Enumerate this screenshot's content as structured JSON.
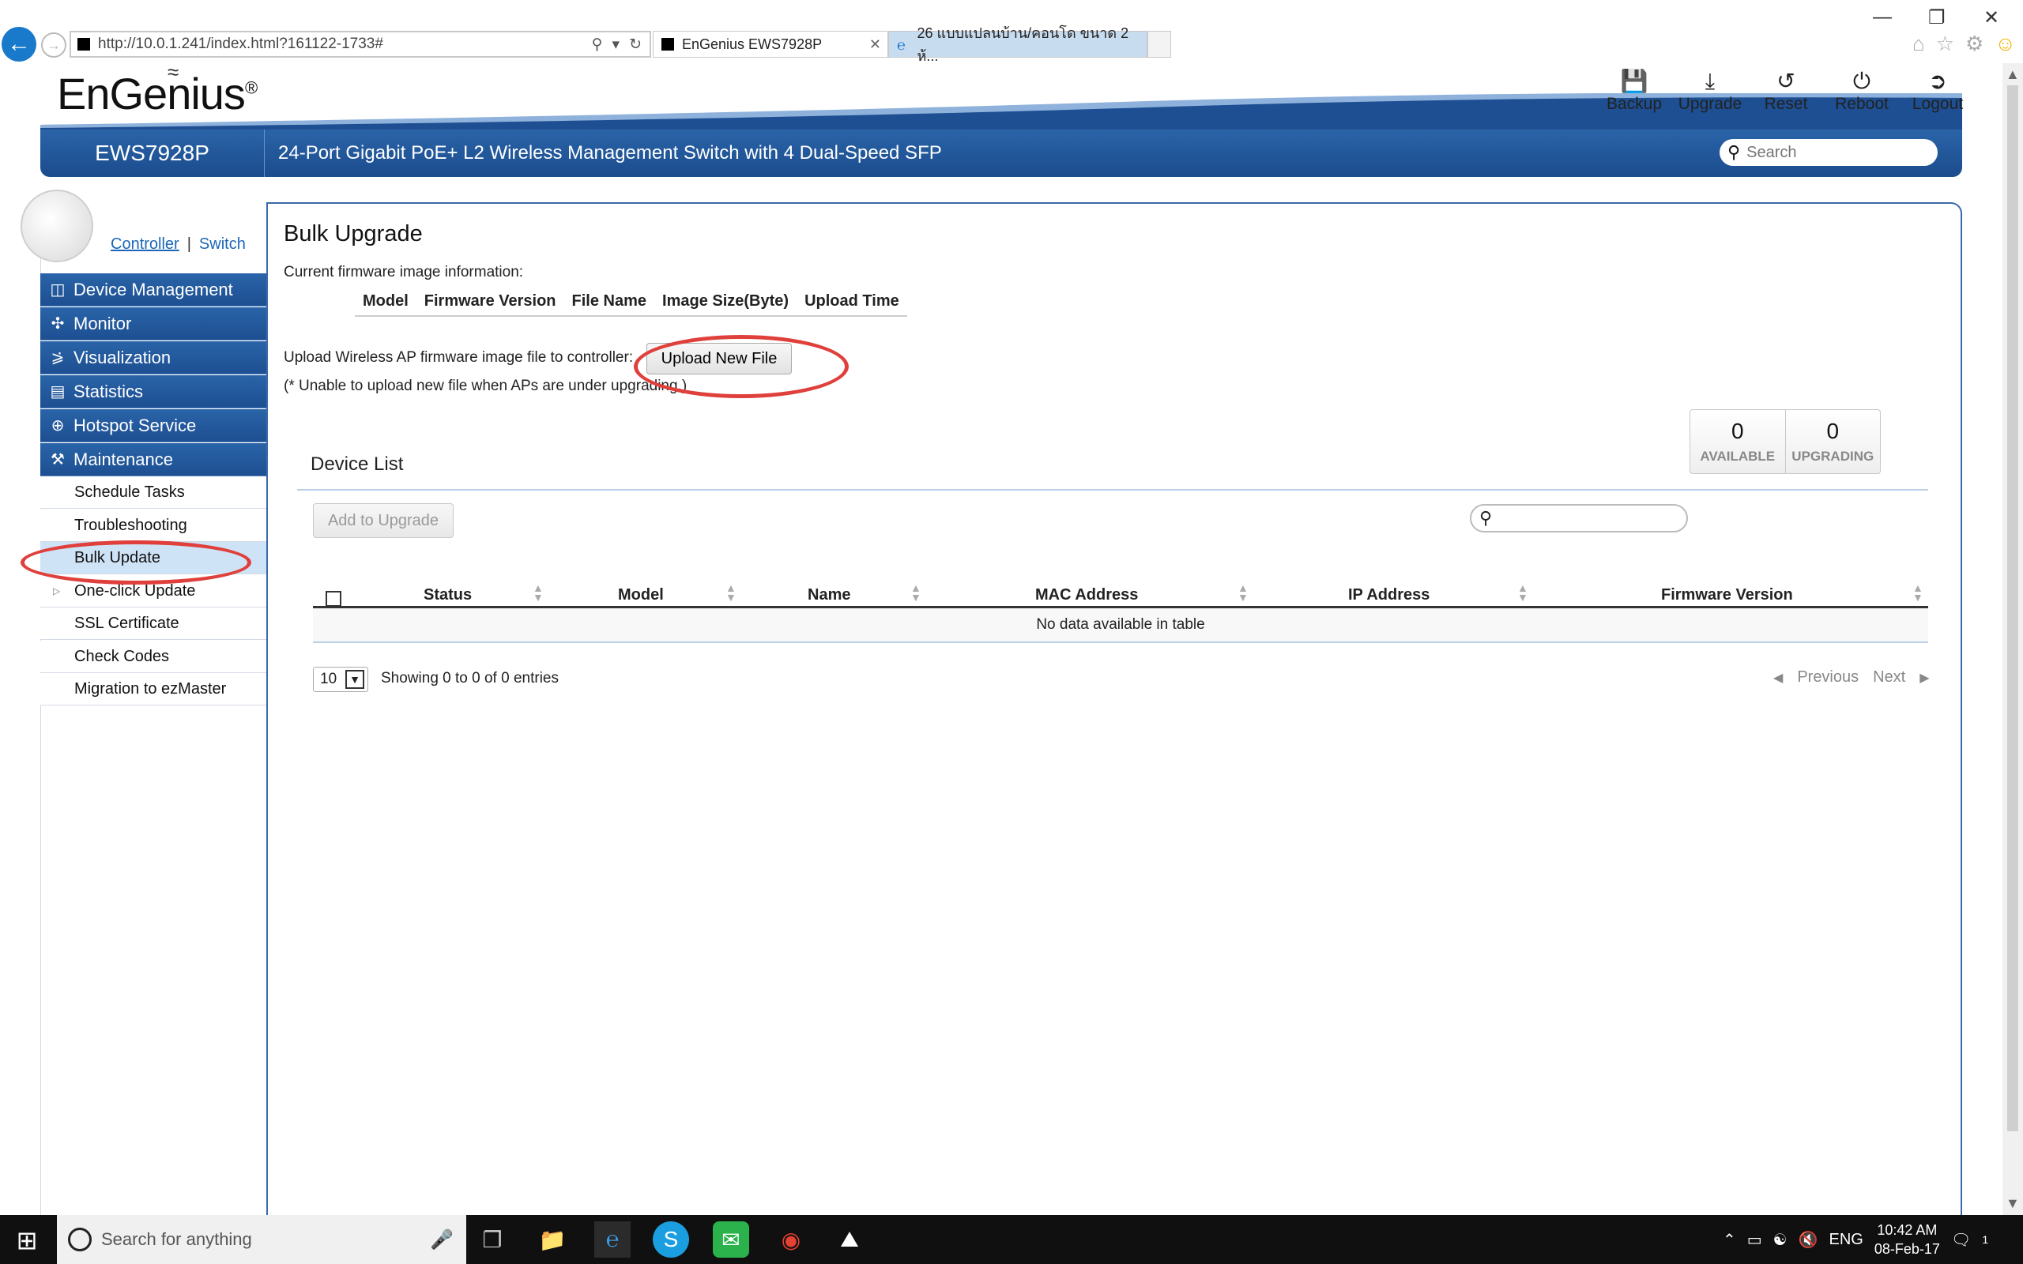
{
  "browser": {
    "url": "http://10.0.1.241/index.html?161122-1733#",
    "tabs": [
      {
        "label": "EnGenius EWS7928P"
      },
      {
        "label": "26 แบบแปลนบ้าน/คอนโด ขนาด 2 ห้..."
      }
    ],
    "icons": [
      "back-icon",
      "forward-icon",
      "search-icon",
      "refresh-icon",
      "home-icon",
      "star-icon",
      "gear-icon",
      "smiley-icon"
    ]
  },
  "app": {
    "brand": "EnGenius",
    "model": "EWS7928P",
    "description": "24-Port Gigabit PoE+ L2 Wireless Management Switch with 4 Dual-Speed SFP",
    "search_placeholder": "Search",
    "top_actions": [
      {
        "label": "Backup",
        "icon": "save-icon"
      },
      {
        "label": "Upgrade",
        "icon": "download-icon"
      },
      {
        "label": "Reset",
        "icon": "reset-icon"
      },
      {
        "label": "Reboot",
        "icon": "power-icon"
      },
      {
        "label": "Logout",
        "icon": "logout-icon"
      }
    ],
    "accent_color": "#1d4f92"
  },
  "sidebar": {
    "role_switch": {
      "controller": "Controller",
      "separator": "|",
      "switch": "Switch"
    },
    "main_items": [
      {
        "label": "Device Management",
        "icon": "device-icon"
      },
      {
        "label": "Monitor",
        "icon": "monitor-icon"
      },
      {
        "label": "Visualization",
        "icon": "share-icon"
      },
      {
        "label": "Statistics",
        "icon": "chart-icon"
      },
      {
        "label": "Hotspot Service",
        "icon": "antenna-icon"
      },
      {
        "label": "Maintenance",
        "icon": "wrench-icon"
      }
    ],
    "sub_items": [
      {
        "label": "Schedule Tasks"
      },
      {
        "label": "Troubleshooting"
      },
      {
        "label": "Bulk Update",
        "active": true
      },
      {
        "label": "One-click Update",
        "expandable": true
      },
      {
        "label": "SSL Certificate"
      },
      {
        "label": "Check Codes"
      },
      {
        "label": "Migration to ezMaster"
      }
    ]
  },
  "main": {
    "title": "Bulk Upgrade",
    "fw_info_label": "Current firmware image information:",
    "fw_columns": [
      "Model",
      "Firmware Version",
      "File Name",
      "Image Size(Byte)",
      "Upload Time"
    ],
    "upload_label": "Upload Wireless AP firmware image file to controller:",
    "upload_button": "Upload New File",
    "upload_note": "(* Unable to upload new file when APs are under upgrading.)",
    "counters": [
      {
        "value": "0",
        "label": "AVAILABLE"
      },
      {
        "value": "0",
        "label": "UPGRADING"
      }
    ],
    "device_list_title": "Device List",
    "add_button": "Add to Upgrade",
    "table": {
      "columns": [
        "Status",
        "Model",
        "Name",
        "MAC Address",
        "IP Address",
        "Firmware Version"
      ],
      "empty_text": "No data available in table"
    },
    "page_size": "10",
    "entries_info": "Showing 0 to 0 of 0 entries",
    "pager": {
      "previous": "Previous",
      "next": "Next"
    }
  },
  "taskbar": {
    "search_placeholder": "Search for anything",
    "tray_lang": "ENG",
    "time": "10:42 AM",
    "date": "08-Feb-17",
    "notification_count": "1"
  }
}
